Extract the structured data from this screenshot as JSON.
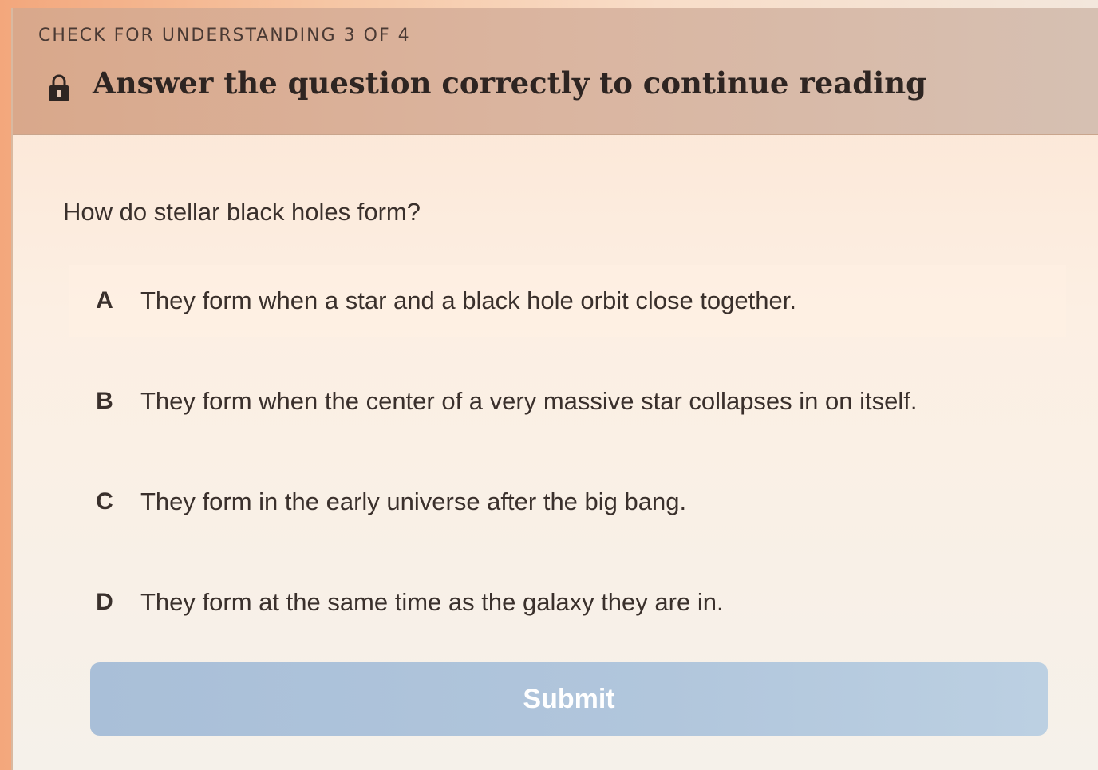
{
  "header": {
    "progress_label": "CHECK FOR UNDERSTANDING 3 OF 4",
    "title": "Answer the question correctly to continue reading",
    "icon": "lock-icon"
  },
  "question": {
    "text": "How do stellar black holes form?"
  },
  "options": [
    {
      "letter": "A",
      "text": "They form when a star and a black hole orbit close together."
    },
    {
      "letter": "B",
      "text": "They form when the center of a very massive star collapses in on itself."
    },
    {
      "letter": "C",
      "text": "They form in the early universe after the big bang."
    },
    {
      "letter": "D",
      "text": "They form at the same time as the galaxy they are in."
    }
  ],
  "submit": {
    "label": "Submit"
  },
  "colors": {
    "header_bg": "#dab5a0",
    "submit_bg": "#b1c6dc",
    "text": "#3a302c"
  }
}
